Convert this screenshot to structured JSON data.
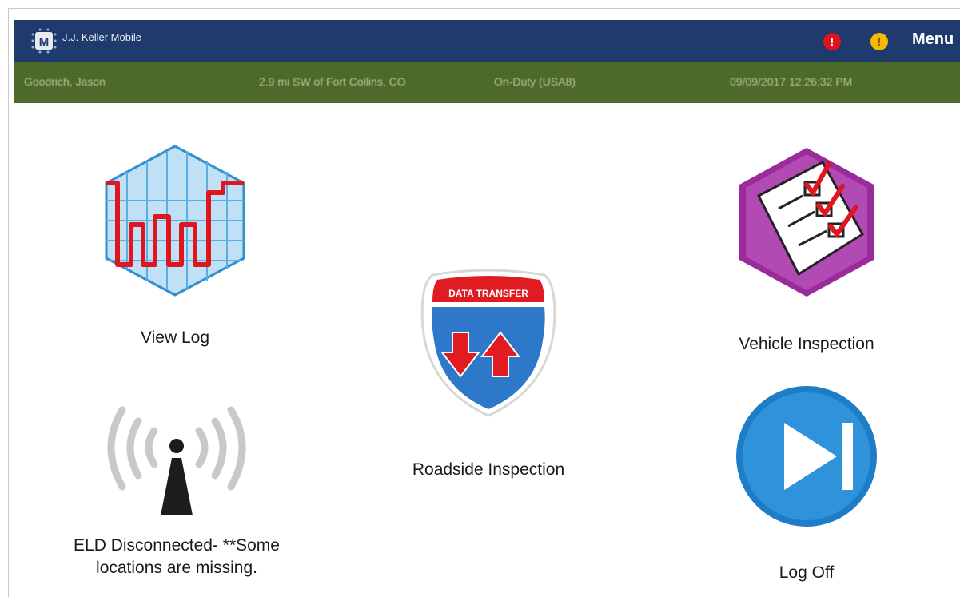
{
  "header": {
    "app_title": "J.J. Keller Mobile",
    "logo_letter": "M",
    "alert_red_symbol": "!",
    "alert_yellow_symbol": "!",
    "menu_label": "Menu",
    "colors": {
      "bar": "#1f3a6c",
      "alert_red": "#e0131d",
      "alert_yellow": "#f7b800"
    }
  },
  "status": {
    "driver": "Goodrich, Jason",
    "location": "2.9 mi SW of Fort Collins, CO",
    "duty": "On-Duty (USA8)",
    "datetime": "09/09/2017 12:26:32 PM",
    "color": "#4d6a2a"
  },
  "tiles": {
    "view_log": {
      "label": "View Log",
      "icon": "log-grid-icon"
    },
    "roadside": {
      "label": "Roadside Inspection",
      "icon": "data-transfer-shield-icon",
      "shield_text": "DATA TRANSFER"
    },
    "vehicle": {
      "label": "Vehicle Inspection",
      "icon": "checklist-icon"
    },
    "eld": {
      "label_line1": "ELD Disconnected- **Some",
      "label_line2": "locations are missing.",
      "icon": "signal-tower-icon"
    },
    "logoff": {
      "label": "Log Off",
      "icon": "skip-forward-icon"
    }
  }
}
